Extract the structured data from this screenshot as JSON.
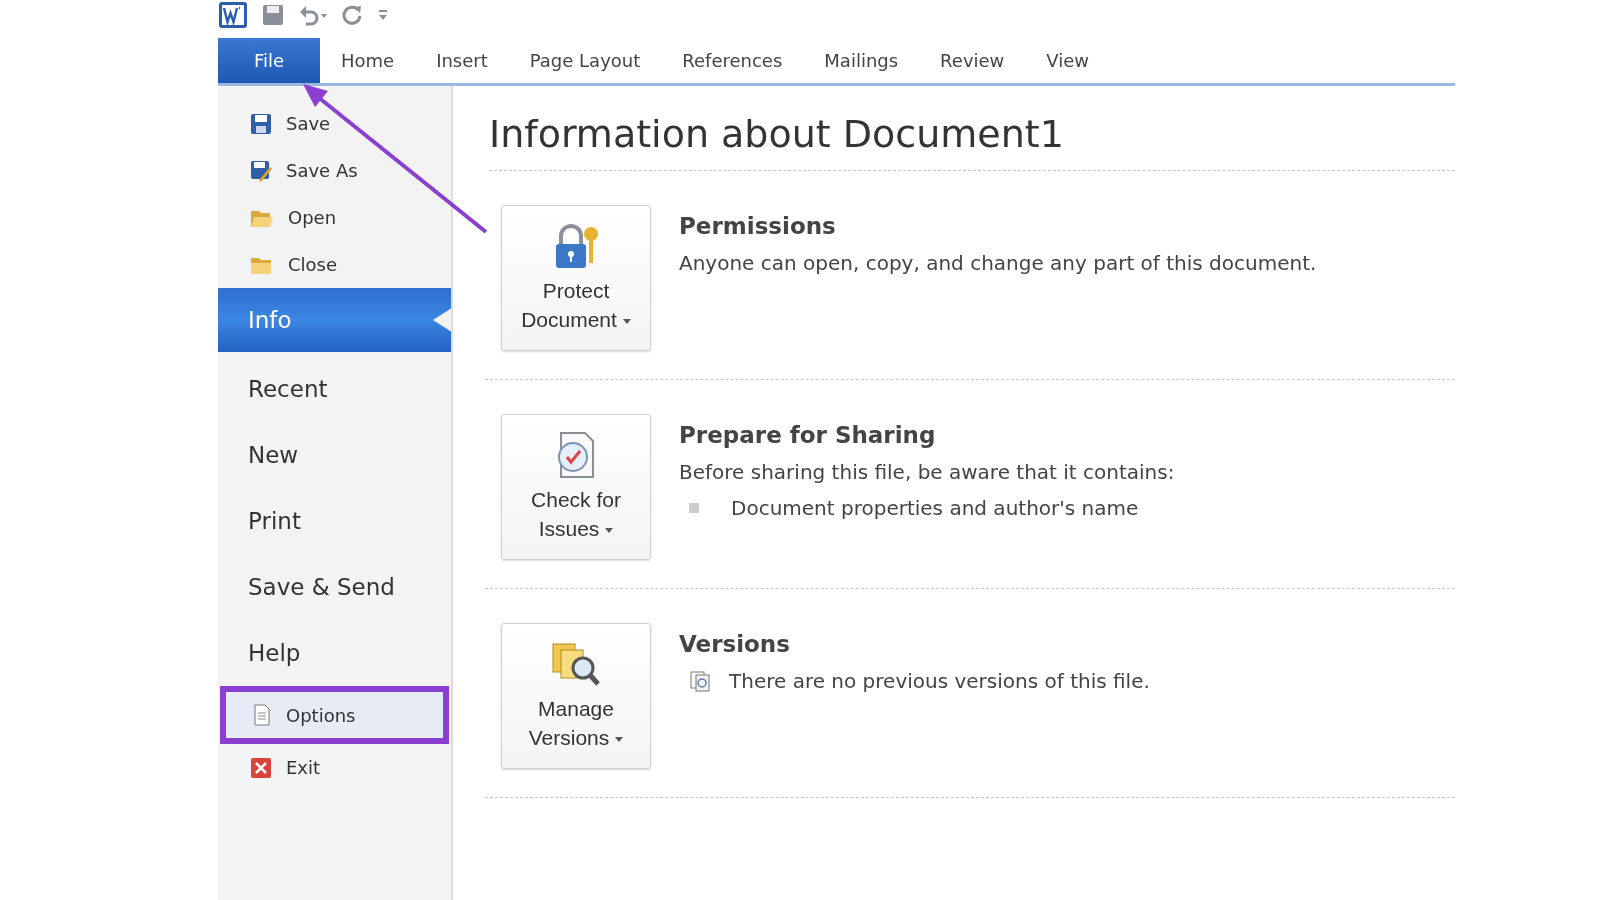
{
  "tabs": [
    {
      "label": "File",
      "selected": true
    },
    {
      "label": "Home",
      "selected": false
    },
    {
      "label": "Insert",
      "selected": false
    },
    {
      "label": "Page Layout",
      "selected": false
    },
    {
      "label": "References",
      "selected": false
    },
    {
      "label": "Mailings",
      "selected": false
    },
    {
      "label": "Review",
      "selected": false
    },
    {
      "label": "View",
      "selected": false
    }
  ],
  "sidebar": {
    "items": [
      {
        "label": "Save",
        "kind": "command",
        "selected": false,
        "highlighted": false
      },
      {
        "label": "Save As",
        "kind": "command",
        "selected": false,
        "highlighted": false
      },
      {
        "label": "Open",
        "kind": "command",
        "selected": false,
        "highlighted": false
      },
      {
        "label": "Close",
        "kind": "command",
        "selected": false,
        "highlighted": false
      },
      {
        "label": "Info",
        "kind": "page",
        "selected": true,
        "highlighted": false
      },
      {
        "label": "Recent",
        "kind": "page",
        "selected": false,
        "highlighted": false
      },
      {
        "label": "New",
        "kind": "page",
        "selected": false,
        "highlighted": false
      },
      {
        "label": "Print",
        "kind": "page",
        "selected": false,
        "highlighted": false
      },
      {
        "label": "Save & Send",
        "kind": "page",
        "selected": false,
        "highlighted": false
      },
      {
        "label": "Help",
        "kind": "page",
        "selected": false,
        "highlighted": false
      },
      {
        "label": "Options",
        "kind": "command",
        "selected": false,
        "highlighted": true
      },
      {
        "label": "Exit",
        "kind": "command",
        "selected": false,
        "highlighted": false
      }
    ]
  },
  "content": {
    "title": "Information about Document1",
    "sections": [
      {
        "button_label": "Protect Document",
        "heading": "Permissions",
        "lines": [
          {
            "kind": "text",
            "text": "Anyone can open, copy, and change any part of this document."
          }
        ]
      },
      {
        "button_label": "Check for Issues",
        "heading": "Prepare for Sharing",
        "lines": [
          {
            "kind": "text",
            "text": "Before sharing this file, be aware that it contains:"
          },
          {
            "kind": "bullet",
            "text": "Document properties and author's name"
          }
        ]
      },
      {
        "button_label": "Manage Versions",
        "heading": "Versions",
        "lines": [
          {
            "kind": "icon_note",
            "text": "There are no previous versions of this file."
          }
        ]
      }
    ]
  }
}
